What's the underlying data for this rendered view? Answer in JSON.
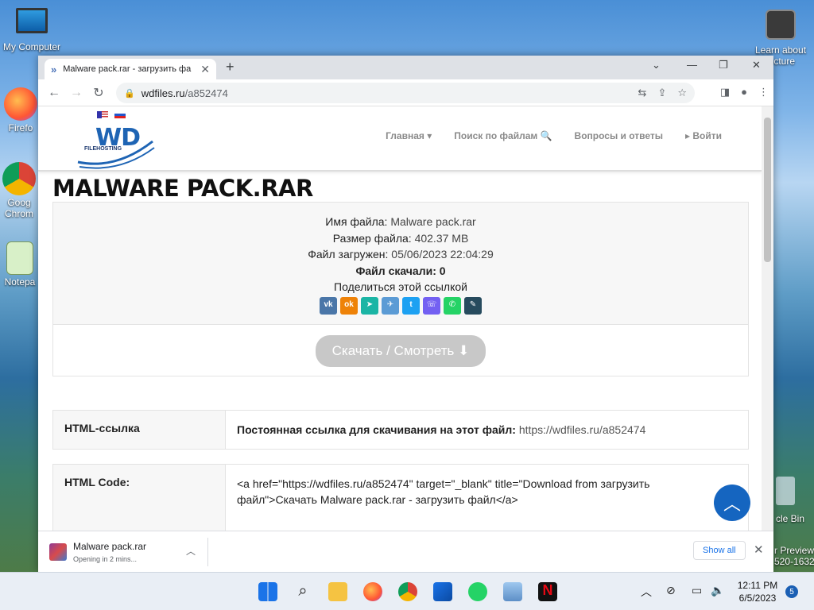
{
  "desktop": {
    "icons": [
      {
        "label": "My Computer"
      },
      {
        "label": "Firefo"
      },
      {
        "label": "Goog Chrom"
      },
      {
        "label": "Notepa"
      }
    ],
    "right_top_label": "Learn about picture",
    "right_bin_label": "cle Bin",
    "right_preview_label": "r Preview",
    "right_build_label": "520-1632"
  },
  "browser": {
    "tab_title": "Malware pack.rar - загрузить фа",
    "url_host": "wdfiles.ru",
    "url_path": "/a852474"
  },
  "site": {
    "logo_text": "WD",
    "logo_sub": "FILEHOSTING",
    "nav": [
      "Главная ▾",
      "Поиск по файлам 🔍",
      "Вопросы и ответы",
      "▸ Войти"
    ],
    "page_title": "MALWARE PACK.RAR",
    "info": {
      "name_label": "Имя файла:",
      "name_value": "Malware pack.rar",
      "size_label": "Размер файла:",
      "size_value": "402.37 MB",
      "uploaded_label": "Файл загружен:",
      "uploaded_value": "05/06/2023 22:04:29",
      "downloads": "Файл скачали: 0",
      "share": "Поделиться этой ссылкой"
    },
    "socials": [
      {
        "label": "vk",
        "color": "#4a76a8"
      },
      {
        "label": "ok",
        "color": "#ee8208"
      },
      {
        "label": "➤",
        "color": "#1bb5a5"
      },
      {
        "label": "✈",
        "color": "#5b9bd5"
      },
      {
        "label": "t",
        "color": "#1da1f2"
      },
      {
        "label": "☏",
        "color": "#7360f2"
      },
      {
        "label": "✆",
        "color": "#25d366"
      },
      {
        "label": "✎",
        "color": "#274b5e"
      }
    ],
    "download_button": "Скачать / Смотреть ⬇",
    "html_link": {
      "key": "HTML-ссылка",
      "label": "Постоянная ссылка для скачивания на этот файл:",
      "url": "https://wdfiles.ru/a852474"
    },
    "html_code": {
      "key": "HTML Code:",
      "value": "<a href=\"https://wdfiles.ru/a852474\" target=\"_blank\" title=\"Download from загрузить файл\">Скачать Malware pack.rar - загрузить файл</a>"
    }
  },
  "download_shelf": {
    "file_name": "Malware pack.rar",
    "status": "Opening in 2 mins...",
    "show_all": "Show all"
  },
  "taskbar": {
    "time": "12:11 PM",
    "date": "6/5/2023",
    "notifications": "5"
  }
}
